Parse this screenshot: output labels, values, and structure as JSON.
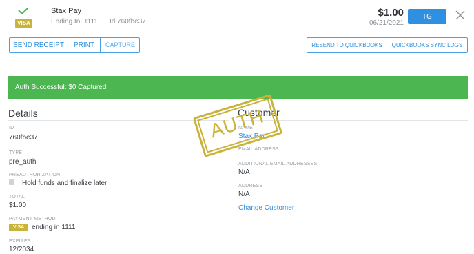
{
  "header": {
    "card_brand": "VISA",
    "merchant": "Stax Pay",
    "ending": "Ending In: 1111",
    "transaction_id": "Id:760fbe37",
    "amount": "$1.00",
    "date": "06/21/2021",
    "user_button": "TG",
    "icons": {
      "success": "check-icon",
      "close": "close-icon"
    }
  },
  "actions": {
    "send_receipt": "SEND RECEIPT",
    "print": "PRINT",
    "capture": "CAPTURE",
    "resend_quickbooks": "RESEND TO QUICKBOOKS",
    "quickbooks_sync_logs": "QUICKBOOKS SYNC LOGS"
  },
  "banner": {
    "text": "Auth Successful: $0 Captured"
  },
  "stamp": {
    "text": "AUTH"
  },
  "details": {
    "title": "Details",
    "id_label": "ID",
    "id_value": "760fbe37",
    "type_label": "TYPE",
    "type_value": "pre_auth",
    "preauth_label": "PREAUTHORIZATION",
    "preauth_value": "Hold funds and finalize later",
    "total_label": "TOTAL",
    "total_value": "$1.00",
    "payment_method_label": "PAYMENT METHOD",
    "payment_brand": "VISA",
    "payment_value": "ending in 1111",
    "expires_label": "EXPIRES",
    "expires_value": "12/2034"
  },
  "customer": {
    "title": "Customer",
    "name_label": "NAME",
    "name_value": "Stax Pay",
    "email_label": "EMAIL ADDRESS",
    "additional_email_label": "ADDITIONAL EMAIL ADDRESSES",
    "additional_email_value": "N/A",
    "address_label": "ADDRESS",
    "address_value": "N/A",
    "change_link": "Change Customer"
  },
  "colors": {
    "success_green": "#4cb750",
    "primary_blue": "#2f8fe0",
    "visa_gold": "#c9b33a"
  }
}
